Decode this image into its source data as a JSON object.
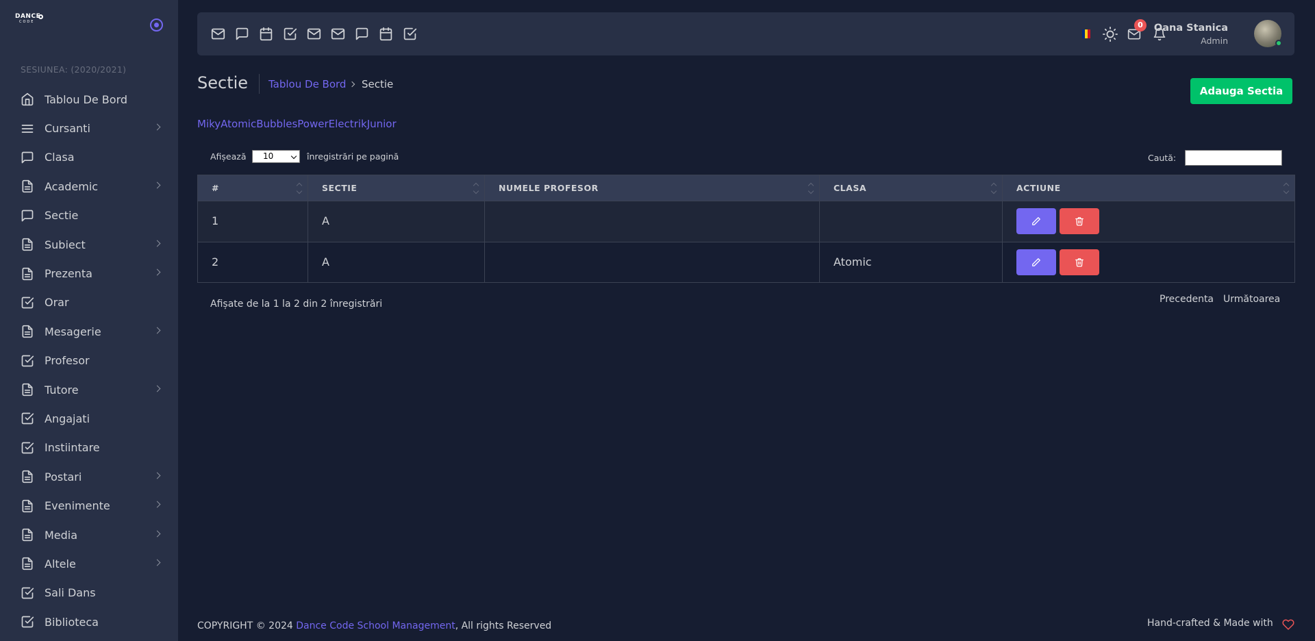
{
  "logo": {
    "line1": "DANCE",
    "line2": "CODE"
  },
  "sidebar": {
    "session": "SESIUNEA: (2020/2021)",
    "items": [
      {
        "label": "Tablou De Bord",
        "icon": "home-icon",
        "chevron": false
      },
      {
        "label": "Cursanti",
        "icon": "list-icon",
        "chevron": true
      },
      {
        "label": "Clasa",
        "icon": "message-square-icon",
        "chevron": false
      },
      {
        "label": "Academic",
        "icon": "file-text-icon",
        "chevron": true
      },
      {
        "label": "Sectie",
        "icon": "message-square-icon",
        "chevron": false
      },
      {
        "label": "Subiect",
        "icon": "file-text-icon",
        "chevron": true
      },
      {
        "label": "Prezenta",
        "icon": "file-text-icon",
        "chevron": true
      },
      {
        "label": "Orar",
        "icon": "check-square-icon",
        "chevron": false
      },
      {
        "label": "Mesagerie",
        "icon": "file-text-icon",
        "chevron": true
      },
      {
        "label": "Profesor",
        "icon": "check-square-icon",
        "chevron": false
      },
      {
        "label": "Tutore",
        "icon": "file-text-icon",
        "chevron": true
      },
      {
        "label": "Angajati",
        "icon": "check-square-icon",
        "chevron": false
      },
      {
        "label": "Instiintare",
        "icon": "check-square-icon",
        "chevron": false
      },
      {
        "label": "Postari",
        "icon": "file-text-icon",
        "chevron": true
      },
      {
        "label": "Evenimente",
        "icon": "file-text-icon",
        "chevron": true
      },
      {
        "label": "Media",
        "icon": "file-text-icon",
        "chevron": true
      },
      {
        "label": "Altele",
        "icon": "file-text-icon",
        "chevron": true
      },
      {
        "label": "Sali Dans",
        "icon": "check-square-icon",
        "chevron": false
      },
      {
        "label": "Biblioteca",
        "icon": "check-square-icon",
        "chevron": false
      }
    ]
  },
  "navbar": {
    "shortcuts": [
      "mail-icon",
      "message-square-icon",
      "calendar-icon",
      "check-square-icon",
      "mail-icon",
      "mail-icon",
      "message-square-icon",
      "calendar-icon",
      "check-square-icon"
    ],
    "mail_badge": "0",
    "user_name": "Oana Stanica",
    "user_role": "Admin",
    "flag_colors": [
      "#002b7f",
      "#fcd116",
      "#ce1126"
    ]
  },
  "header": {
    "title": "Sectie",
    "breadcrumb_home": "Tablou De Bord",
    "breadcrumb_current": "Sectie",
    "add_button": "Adauga Sectia"
  },
  "filters": [
    "Miky",
    "Atomic",
    "Bubbles",
    "Power",
    "Electrik",
    "Junior"
  ],
  "table_controls": {
    "show_label": "Afișează",
    "page_size": "10",
    "show_suffix": "înregistrări pe pagină",
    "search_label": "Caută:"
  },
  "table": {
    "headers": [
      "#",
      "SECTIE",
      "NUMELE PROFESOR",
      "CLASA",
      "ACTIUNE"
    ],
    "rows": [
      {
        "num": "1",
        "sectie": "A",
        "profesor": "",
        "clasa": ""
      },
      {
        "num": "2",
        "sectie": "A",
        "profesor": "",
        "clasa": "Atomic"
      }
    ]
  },
  "pagination": {
    "info": "Afișate de la 1 la 2 din 2 înregistrări",
    "prev": "Precedenta",
    "next": "Următoarea"
  },
  "footer": {
    "copyright": "COPYRIGHT © 2024 ",
    "brand": "Dance Code School Management",
    "rights": ", All rights Reserved",
    "made_with": "Hand-crafted & Made with"
  },
  "colors": {
    "accent": "#7367f0",
    "success": "#00c26a",
    "danger": "#ea5455",
    "background": "#161d31",
    "card": "#283046"
  }
}
